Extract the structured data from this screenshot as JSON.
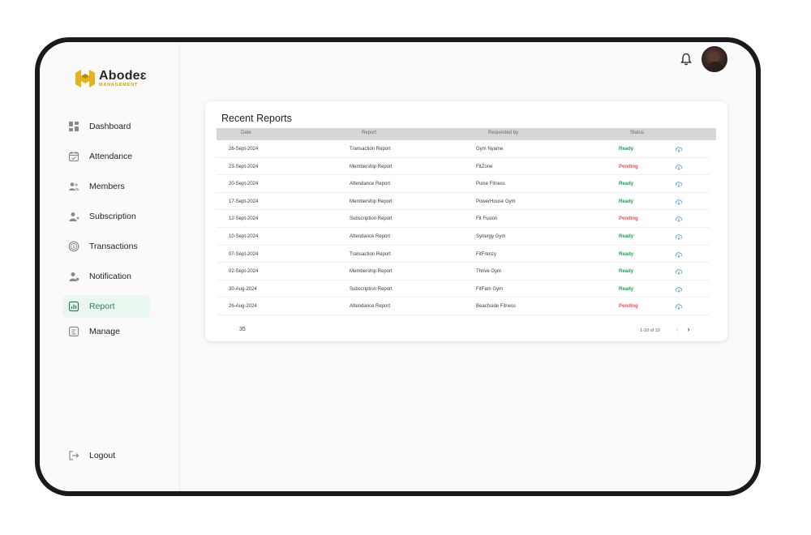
{
  "brand": {
    "name": "Abodeɛ",
    "sub": "MANAGEMENT",
    "accent": "#E6B31E"
  },
  "nav": [
    {
      "label": "Dashboard",
      "icon": "dashboard-icon"
    },
    {
      "label": "Attendance",
      "icon": "calendar-icon"
    },
    {
      "label": "Members",
      "icon": "users-icon"
    },
    {
      "label": "Subscription",
      "icon": "user-plus-icon"
    },
    {
      "label": "Transactions",
      "icon": "coin-icon"
    },
    {
      "label": "Notification",
      "icon": "user-bell-icon"
    },
    {
      "label": "Report",
      "icon": "chart-icon",
      "active": true
    },
    {
      "label": "Manage",
      "icon": "manage-icon"
    }
  ],
  "logout": "Logout",
  "report": {
    "title": "Recent Reports",
    "columns": [
      "Date",
      "Report",
      "Requested by",
      "Status"
    ],
    "rows": [
      {
        "date": "26-Sept-2024",
        "report": "Transaction Report",
        "by": "Gym Nyame",
        "status": "Ready"
      },
      {
        "date": "23-Sept-2024",
        "report": "Membership Report",
        "by": "FitZone",
        "status": "Pending"
      },
      {
        "date": "20-Sept-2024",
        "report": "Attendance Report",
        "by": "Pulse Fitness",
        "status": "Ready"
      },
      {
        "date": "17-Sept-2024",
        "report": "Membership Report",
        "by": "PowerHouse Gym",
        "status": "Ready"
      },
      {
        "date": "12-Sept-2024",
        "report": "Subscription Report",
        "by": "Fit Fusion",
        "status": "Pending"
      },
      {
        "date": "10-Sept-2024",
        "report": "Attendance Report",
        "by": "Synergy Gym",
        "status": "Ready"
      },
      {
        "date": "07-Sept-2024",
        "report": "Transaction Report",
        "by": "FitFrenzy",
        "status": "Ready"
      },
      {
        "date": "02-Sept-2024",
        "report": "Membership Report",
        "by": "Thrive Gym",
        "status": "Ready"
      },
      {
        "date": "30-Aug-2024",
        "report": "Subscription Report",
        "by": "FitFam Gym",
        "status": "Ready"
      },
      {
        "date": "26-Aug-2024",
        "report": "Attendance Report",
        "by": "Beachside Fitness",
        "status": "Pending"
      }
    ],
    "total": "35",
    "range": "1-10 of 10"
  },
  "colors": {
    "ready": "#1f9d55",
    "pending": "#e0554f",
    "download": "#5aa6d6",
    "active_bg": "#eaf7ee"
  }
}
